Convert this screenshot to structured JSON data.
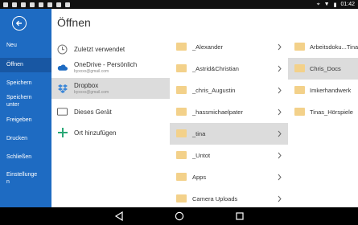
{
  "statusbar": {
    "time": "01:42"
  },
  "nav": {
    "items": [
      {
        "label": "Neu"
      },
      {
        "label": "Öffnen"
      },
      {
        "label": "Speichern"
      },
      {
        "label": "Speichern unter"
      },
      {
        "label": "Freigeben"
      },
      {
        "label": "Drucken"
      },
      {
        "label": "Schließen"
      },
      {
        "label": "Einstellungen"
      }
    ]
  },
  "page": {
    "title": "Öffnen"
  },
  "places": [
    {
      "name": "Zuletzt verwendet",
      "sub": "",
      "icon": "clock-icon"
    },
    {
      "name": "OneDrive - Persönlich",
      "sub": "byxxxx@gmail.com",
      "icon": "cloud-icon"
    },
    {
      "name": "Dropbox",
      "sub": "byxxxx@gmail.com",
      "icon": "dropbox-icon"
    },
    {
      "name": "Dieses Gerät",
      "sub": "",
      "icon": "tablet-icon"
    },
    {
      "name": "Ort hinzufügen",
      "sub": "",
      "icon": "plus-icon"
    }
  ],
  "folders": [
    {
      "name": "_Alexander"
    },
    {
      "name": "_Astrid&Christian"
    },
    {
      "name": "_chris_Augustin"
    },
    {
      "name": "_hassmichaelpater"
    },
    {
      "name": "_tina"
    },
    {
      "name": "_Untot"
    },
    {
      "name": "Apps"
    },
    {
      "name": "Camera Uploads"
    }
  ],
  "subfolders": [
    {
      "name": "Arbeitsdoku...Tina"
    },
    {
      "name": "Chris_Docs"
    },
    {
      "name": "Imkerhandwerk"
    },
    {
      "name": "Tinas_Hörspiele"
    }
  ],
  "colors": {
    "accent": "#1e6bc2",
    "nav_active": "#1857a3",
    "selected": "#dcdcdc",
    "folder": "#f3d18a"
  }
}
